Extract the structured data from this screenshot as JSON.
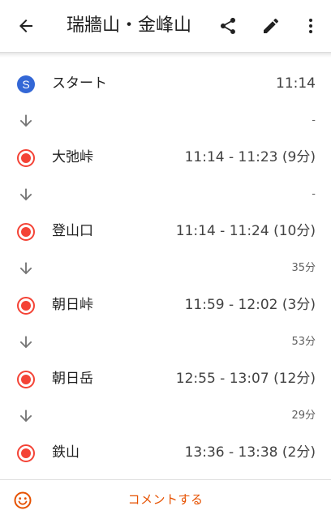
{
  "header": {
    "title": "瑞牆山・金峰山",
    "back_icon": "arrow-back-icon",
    "share_icon": "share-icon",
    "edit_icon": "edit-icon",
    "more_icon": "more-vert-icon"
  },
  "colors": {
    "start_badge": "#3367d6",
    "stop_marker": "#f44336",
    "accent_comment": "#e65100"
  },
  "route": {
    "start": {
      "badge": "S",
      "name": "スタート",
      "time": "11:14"
    },
    "legs": [
      {
        "duration": "-"
      },
      {
        "duration": "-"
      },
      {
        "duration": "35分"
      },
      {
        "duration": "53分"
      },
      {
        "duration": "29分"
      }
    ],
    "stops": [
      {
        "name": "大弛峠",
        "time": "11:14 - 11:23 (9分)"
      },
      {
        "name": "登山口",
        "time": "11:14 - 11:24 (10分)"
      },
      {
        "name": "朝日峠",
        "time": "11:59 - 12:02 (3分)"
      },
      {
        "name": "朝日岳",
        "time": "12:55 - 13:07 (12分)"
      },
      {
        "name": "鉄山",
        "time": "13:36 - 13:38 (2分)"
      }
    ]
  },
  "footer": {
    "comment_label": "コメントする",
    "smile_icon": "smile-icon"
  }
}
